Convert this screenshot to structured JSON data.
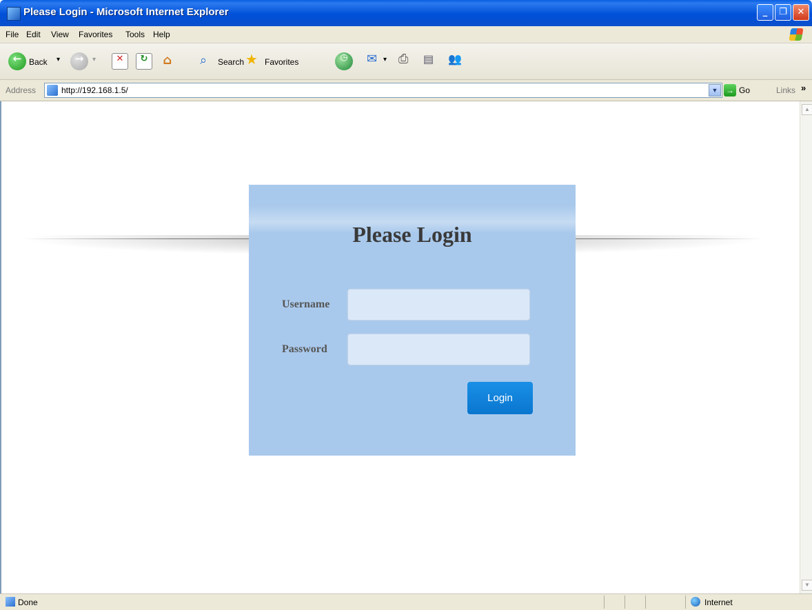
{
  "window": {
    "title": "Please Login - Microsoft Internet Explorer",
    "controls": [
      "minimize",
      "restore",
      "close"
    ]
  },
  "menu": {
    "items": [
      "File",
      "Edit",
      "View",
      "Favorites",
      "Tools",
      "Help"
    ]
  },
  "toolbar": {
    "back_label": "Back",
    "back_dropdown": "▾",
    "search_label": "Search",
    "favorites_label": "Favorites"
  },
  "address": {
    "label": "Address",
    "url": "http://192.168.1.5/",
    "go_label": "Go",
    "links_label": "Links",
    "links_chevron": "»"
  },
  "login": {
    "title": "Please Login",
    "username_label": "Username",
    "password_label": "Password",
    "button_label": "Login",
    "username_value": "",
    "password_value": ""
  },
  "status": {
    "text": "Done",
    "zone": "Internet"
  },
  "colors": {
    "panel": "#a9c9ec",
    "button": "#0a7fd8",
    "titlebar": "#0a53d6"
  }
}
